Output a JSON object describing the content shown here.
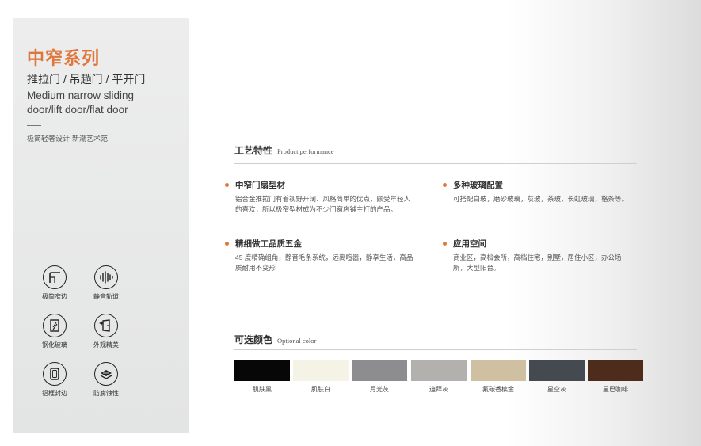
{
  "series": {
    "title": "中窄系列",
    "subtitle": "推拉门 / 吊趟门 / 平开门",
    "english": "Medium narrow sliding door/lift door/flat door",
    "slogan": "极简轻奢设计·新潮艺术范"
  },
  "features": [
    {
      "label": "极简窄边",
      "icon": "corner-frame-icon"
    },
    {
      "label": "静音轨道",
      "icon": "sound-wave-icon"
    },
    {
      "label": "钢化玻璃",
      "icon": "glass-panel-icon"
    },
    {
      "label": "外观精美",
      "icon": "door-sparkle-icon"
    },
    {
      "label": "铝框封边",
      "icon": "aluminum-frame-icon"
    },
    {
      "label": "防腐蚀性",
      "icon": "anti-corrosion-icon"
    }
  ],
  "process": {
    "title_zh": "工艺特性",
    "title_en": "Product performance",
    "items": [
      {
        "title": "中窄门扇型材",
        "desc": "铝合金推拉门有着视野开阔、风格简单的优点，颇受年轻人的喜欢，所以极窄型材成为不少门窗店铺主打的产品。"
      },
      {
        "title": "多种玻璃配置",
        "desc": "可搭配白玻，磨砂玻璃，灰玻，茶玻，长虹玻璃，格条等。"
      },
      {
        "title": "精细做工品质五金",
        "desc": "45 度精确组角，静音毛条系统，远离喧嚣，静享生活，高品质耐用不变形"
      },
      {
        "title": "应用空间",
        "desc": "商业区，高档会所，高档住宅，别墅，居住小区，办公场所，大型阳台。"
      }
    ]
  },
  "colors": {
    "title_zh": "可选颜色",
    "title_en": "Optional color",
    "swatches": [
      {
        "name": "肌肤黑",
        "color": "#070707"
      },
      {
        "name": "肌肤白",
        "color": "#f5f2e6"
      },
      {
        "name": "月光灰",
        "color": "#8d8d8f"
      },
      {
        "name": "迪拜灰",
        "color": "#b3b1ad"
      },
      {
        "name": "氟碳香槟金",
        "color": "#cfc0a2"
      },
      {
        "name": "星空灰",
        "color": "#454a50"
      },
      {
        "name": "星巴咖啡",
        "color": "#4e2c1c"
      }
    ]
  }
}
